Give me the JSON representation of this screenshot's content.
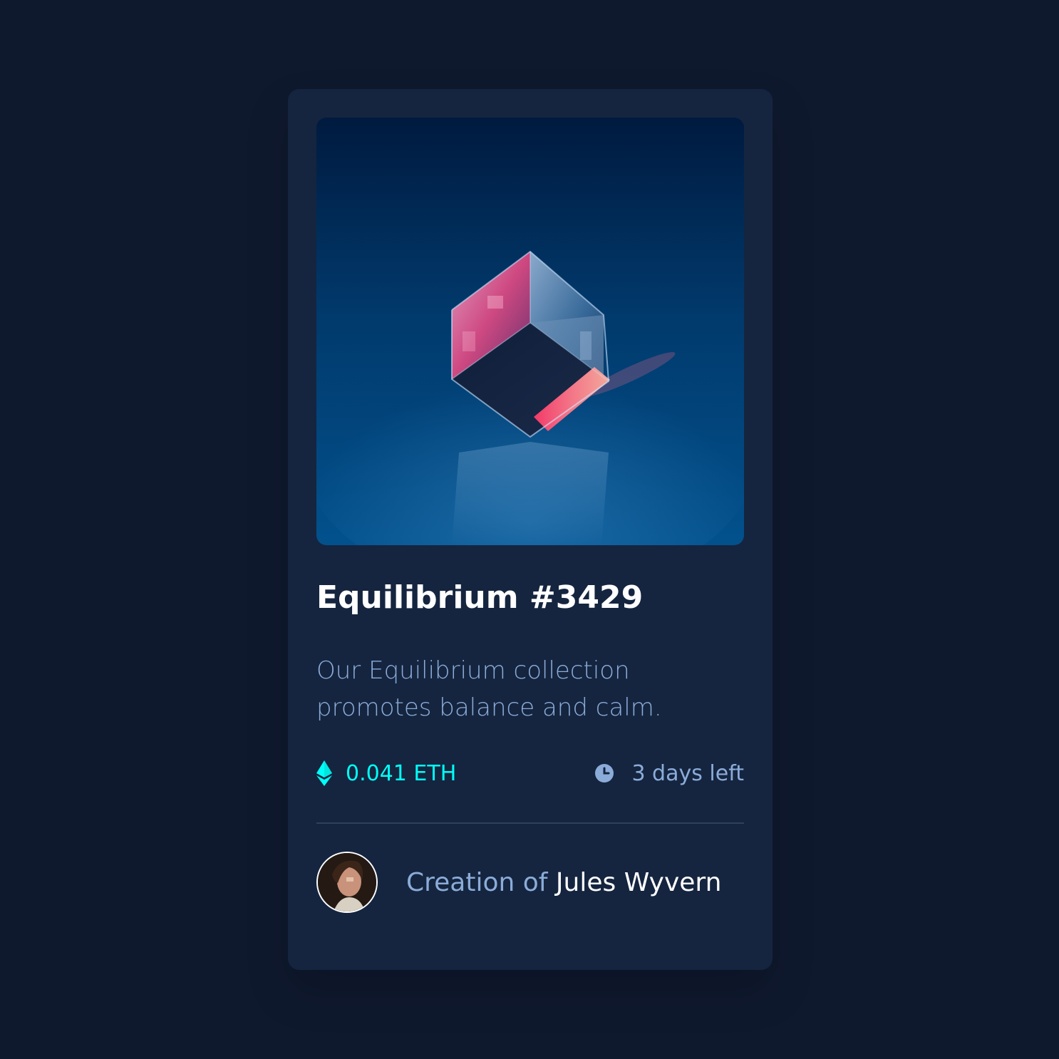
{
  "card": {
    "title": "Equilibrium #3429",
    "description_line1": "Our Equilibrium collection",
    "description_line2": "promotes balance and calm.",
    "price": "0.041 ETH",
    "time_left": "3 days left",
    "creator_prefix": "Creation of ",
    "creator_name": "Jules Wyvern"
  },
  "icons": {
    "price": "ethereum-icon",
    "time": "clock-icon"
  },
  "colors": {
    "page_background": "#0f192e",
    "card_background": "#15253f",
    "accent_cyan": "#00fff8",
    "soft_blue_text": "#8bacd9",
    "white_text": "#ffffff",
    "divider": "#2e405a"
  }
}
